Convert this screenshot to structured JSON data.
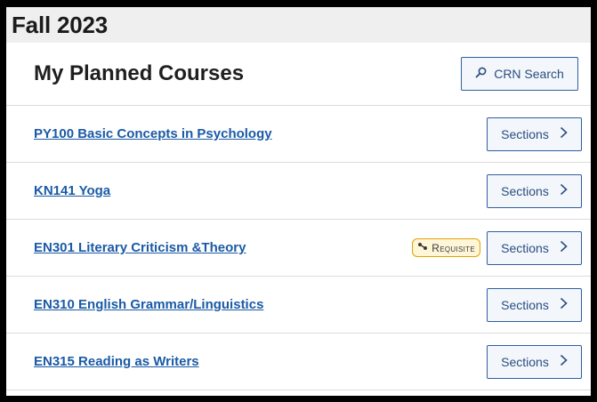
{
  "term": {
    "title": "Fall 2023"
  },
  "header": {
    "title": "My Planned Courses",
    "crn_search_label": "CRN Search"
  },
  "courses": [
    {
      "name": "PY100 Basic Concepts in Psychology",
      "requisite": "",
      "sections_label": "Sections"
    },
    {
      "name": "KN141 Yoga",
      "requisite": "",
      "sections_label": "Sections"
    },
    {
      "name": "EN301 Literary Criticism &Theory",
      "requisite": "Requisite",
      "sections_label": "Sections"
    },
    {
      "name": "EN310 English Grammar/Linguistics",
      "requisite": "",
      "sections_label": "Sections"
    },
    {
      "name": "EN315 Reading as Writers",
      "requisite": "",
      "sections_label": "Sections"
    }
  ],
  "colors": {
    "link": "#1a5aa6",
    "button_border": "#2f5f9e",
    "requisite_border": "#e0a400"
  }
}
